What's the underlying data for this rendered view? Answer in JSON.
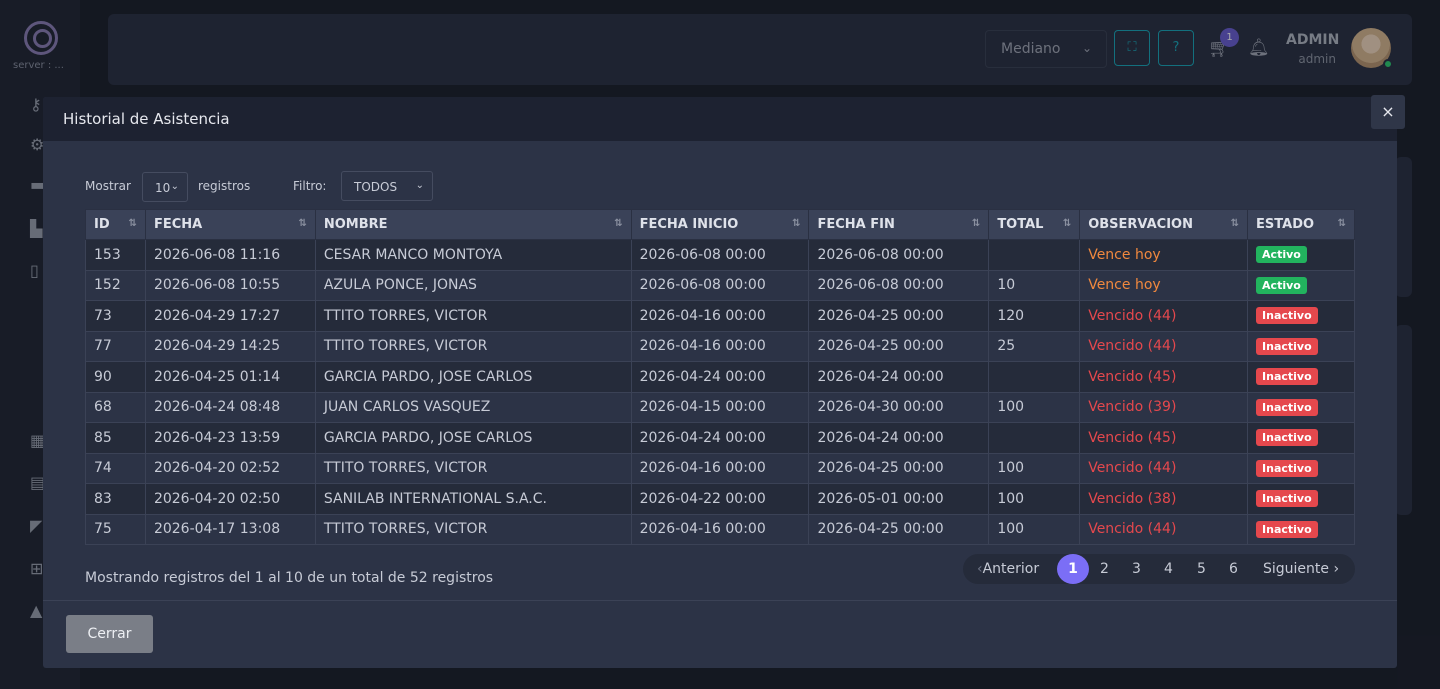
{
  "sidebar": {
    "server_label": "server : ..."
  },
  "topbar": {
    "size_select": "Mediano",
    "cart_count": "1",
    "user_name": "ADMIN",
    "user_role": "admin"
  },
  "modal": {
    "title": "Historial de Asistencia",
    "close_label": "×",
    "show_label": "Mostrar",
    "show_value": "10",
    "records_label": "registros",
    "filter_label": "Filtro:",
    "filter_value": "TODOS",
    "columns": [
      "ID",
      "FECHA",
      "NOMBRE",
      "FECHA INICIO",
      "FECHA FIN",
      "TOTAL",
      "OBSERVACION",
      "ESTADO"
    ],
    "rows": [
      {
        "id": "153",
        "fecha": "2026-06-08 11:16",
        "nombre": "CESAR MANCO MONTOYA",
        "inicio": "2026-06-08 00:00",
        "fin": "2026-06-08 00:00",
        "total": "",
        "obs": "Vence hoy",
        "obs_type": "warn",
        "estado": "Activo",
        "estado_type": "ok"
      },
      {
        "id": "152",
        "fecha": "2026-06-08 10:55",
        "nombre": "AZULA PONCE, JONAS",
        "inicio": "2026-06-08 00:00",
        "fin": "2026-06-08 00:00",
        "total": "10",
        "obs": "Vence hoy",
        "obs_type": "warn",
        "estado": "Activo",
        "estado_type": "ok"
      },
      {
        "id": "73",
        "fecha": "2026-04-29 17:27",
        "nombre": "TTITO TORRES, VICTOR",
        "inicio": "2026-04-16 00:00",
        "fin": "2026-04-25 00:00",
        "total": "120",
        "obs": "Vencido (44)",
        "obs_type": "bad",
        "estado": "Inactivo",
        "estado_type": "bad"
      },
      {
        "id": "77",
        "fecha": "2026-04-29 14:25",
        "nombre": "TTITO TORRES, VICTOR",
        "inicio": "2026-04-16 00:00",
        "fin": "2026-04-25 00:00",
        "total": "25",
        "obs": "Vencido (44)",
        "obs_type": "bad",
        "estado": "Inactivo",
        "estado_type": "bad"
      },
      {
        "id": "90",
        "fecha": "2026-04-25 01:14",
        "nombre": "GARCIA PARDO, JOSE CARLOS",
        "inicio": "2026-04-24 00:00",
        "fin": "2026-04-24 00:00",
        "total": "",
        "obs": "Vencido (45)",
        "obs_type": "bad",
        "estado": "Inactivo",
        "estado_type": "bad"
      },
      {
        "id": "68",
        "fecha": "2026-04-24 08:48",
        "nombre": "JUAN CARLOS VASQUEZ",
        "inicio": "2026-04-15 00:00",
        "fin": "2026-04-30 00:00",
        "total": "100",
        "obs": "Vencido (39)",
        "obs_type": "bad",
        "estado": "Inactivo",
        "estado_type": "bad"
      },
      {
        "id": "85",
        "fecha": "2026-04-23 13:59",
        "nombre": "GARCIA PARDO, JOSE CARLOS",
        "inicio": "2026-04-24 00:00",
        "fin": "2026-04-24 00:00",
        "total": "",
        "obs": "Vencido (45)",
        "obs_type": "bad",
        "estado": "Inactivo",
        "estado_type": "bad"
      },
      {
        "id": "74",
        "fecha": "2026-04-20 02:52",
        "nombre": "TTITO TORRES, VICTOR",
        "inicio": "2026-04-16 00:00",
        "fin": "2026-04-25 00:00",
        "total": "100",
        "obs": "Vencido (44)",
        "obs_type": "bad",
        "estado": "Inactivo",
        "estado_type": "bad"
      },
      {
        "id": "83",
        "fecha": "2026-04-20 02:50",
        "nombre": "SANILAB INTERNATIONAL S.A.C.",
        "inicio": "2026-04-22 00:00",
        "fin": "2026-05-01 00:00",
        "total": "100",
        "obs": "Vencido (38)",
        "obs_type": "bad",
        "estado": "Inactivo",
        "estado_type": "bad"
      },
      {
        "id": "75",
        "fecha": "2026-04-17 13:08",
        "nombre": "TTITO TORRES, VICTOR",
        "inicio": "2026-04-16 00:00",
        "fin": "2026-04-25 00:00",
        "total": "100",
        "obs": "Vencido (44)",
        "obs_type": "bad",
        "estado": "Inactivo",
        "estado_type": "bad"
      }
    ],
    "info_text": "Mostrando registros del 1 al 10 de un total de 52 registros",
    "pagination": {
      "prev": "Anterior",
      "pages": [
        "1",
        "2",
        "3",
        "4",
        "5",
        "6"
      ],
      "current": "1",
      "next": "Siguiente"
    },
    "close_button": "Cerrar"
  },
  "colors": {
    "accent": "#7b6ef6",
    "teal": "#1aa7b8",
    "warn": "#f0883e",
    "danger": "#e5484d",
    "success": "#22b35e"
  }
}
